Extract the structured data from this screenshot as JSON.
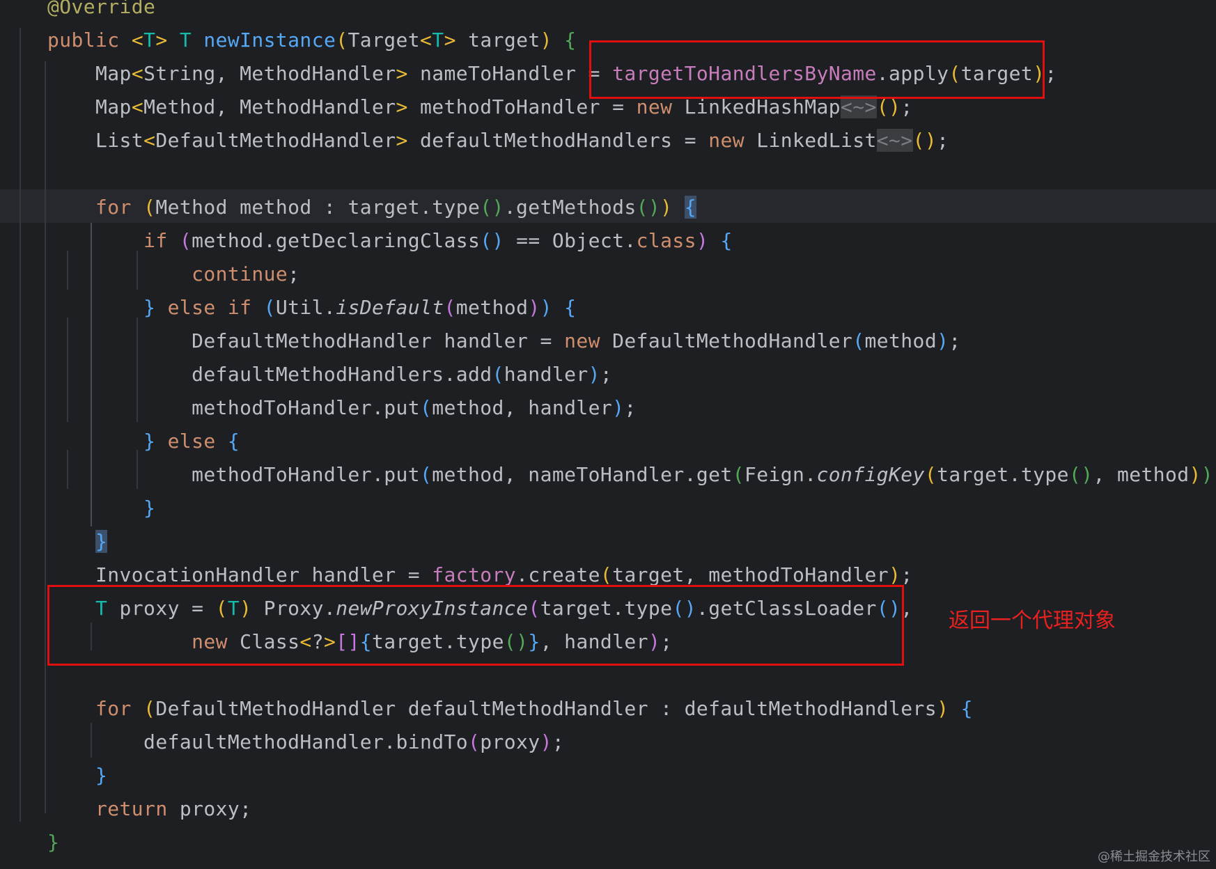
{
  "colors": {
    "background": "#1e1f22",
    "keyword": "#cf8e6d",
    "method": "#56a8f5",
    "field": "#c77dbb",
    "type_param": "#16baac",
    "annotation": "#b3ae60",
    "highlight_box": "#e01010"
  },
  "code": {
    "lines": [
      [
        [
          "@Override",
          "ann"
        ]
      ],
      [
        [
          "public ",
          "kw"
        ],
        [
          "<",
          "p1"
        ],
        [
          "T",
          "tp"
        ],
        [
          "> ",
          "p1"
        ],
        [
          "T ",
          "tp"
        ],
        [
          "newInstance",
          "fn"
        ],
        [
          "(",
          "p1"
        ],
        [
          "Target",
          "type"
        ],
        [
          "<",
          "p1"
        ],
        [
          "T",
          "tp"
        ],
        [
          "> ",
          "p1"
        ],
        [
          "target",
          ""
        ],
        [
          ") ",
          "p1"
        ],
        [
          "{",
          "p4"
        ]
      ],
      [
        [
          "    Map",
          ""
        ],
        [
          "<",
          "p1"
        ],
        [
          "String, MethodHandler",
          ""
        ],
        [
          "> ",
          "p1"
        ],
        [
          "nameToHandler = ",
          ""
        ],
        [
          "targetToHandlersByName",
          "field"
        ],
        [
          ".apply",
          ""
        ],
        [
          "(",
          "p1"
        ],
        [
          "target",
          ""
        ],
        [
          ")",
          "p1"
        ],
        [
          ";",
          ""
        ]
      ],
      [
        [
          "    Map",
          ""
        ],
        [
          "<",
          "p1"
        ],
        [
          "Method, MethodHandler",
          ""
        ],
        [
          "> ",
          "p1"
        ],
        [
          "methodToHandler = ",
          ""
        ],
        [
          "new ",
          "kw"
        ],
        [
          "LinkedHashMap",
          ""
        ],
        [
          "<~>",
          "dim"
        ],
        [
          "()",
          "p1"
        ],
        [
          ";",
          ""
        ]
      ],
      [
        [
          "    List",
          ""
        ],
        [
          "<",
          "p1"
        ],
        [
          "DefaultMethodHandler",
          ""
        ],
        [
          "> ",
          "p1"
        ],
        [
          "defaultMethodHandlers = ",
          ""
        ],
        [
          "new ",
          "kw"
        ],
        [
          "LinkedList",
          ""
        ],
        [
          "<~>",
          "dim"
        ],
        [
          "()",
          "p1"
        ],
        [
          ";",
          ""
        ]
      ],
      [
        [
          "",
          ""
        ]
      ],
      [
        [
          "    ",
          ""
        ],
        [
          "for ",
          "kw"
        ],
        [
          "(",
          "p1"
        ],
        [
          "Method method : target.type",
          ""
        ],
        [
          "()",
          "p4"
        ],
        [
          ".getMethods",
          ""
        ],
        [
          "()",
          "p4"
        ],
        [
          ")",
          "p1"
        ],
        [
          " ",
          ""
        ],
        [
          "{",
          "match"
        ]
      ],
      [
        [
          "        ",
          ""
        ],
        [
          "if ",
          "kw"
        ],
        [
          "(",
          "p2"
        ],
        [
          "method.getDeclaringClass",
          ""
        ],
        [
          "()",
          "p3"
        ],
        [
          " == Object.",
          ""
        ],
        [
          "class",
          "kw"
        ],
        [
          ") ",
          "p2"
        ],
        [
          "{",
          "p3"
        ]
      ],
      [
        [
          "            ",
          ""
        ],
        [
          "continue",
          "kw"
        ],
        [
          ";",
          ""
        ]
      ],
      [
        [
          "        ",
          ""
        ],
        [
          "} ",
          "p3"
        ],
        [
          "else if ",
          "kw"
        ],
        [
          "(",
          "p3"
        ],
        [
          "Util.",
          ""
        ],
        [
          "isDefault",
          "italic"
        ],
        [
          "(",
          "p2"
        ],
        [
          "method",
          ""
        ],
        [
          ")",
          "p2"
        ],
        [
          ") ",
          "p3"
        ],
        [
          "{",
          "p3"
        ]
      ],
      [
        [
          "            DefaultMethodHandler handler = ",
          ""
        ],
        [
          "new ",
          "kw"
        ],
        [
          "DefaultMethodHandler",
          ""
        ],
        [
          "(",
          "p3"
        ],
        [
          "method",
          ""
        ],
        [
          ")",
          "p3"
        ],
        [
          ";",
          ""
        ]
      ],
      [
        [
          "            defaultMethodHandlers.add",
          ""
        ],
        [
          "(",
          "p3"
        ],
        [
          "handler",
          ""
        ],
        [
          ")",
          "p3"
        ],
        [
          ";",
          ""
        ]
      ],
      [
        [
          "            methodToHandler.put",
          ""
        ],
        [
          "(",
          "p3"
        ],
        [
          "method, handler",
          ""
        ],
        [
          ")",
          "p3"
        ],
        [
          ";",
          ""
        ]
      ],
      [
        [
          "        ",
          ""
        ],
        [
          "} ",
          "p3"
        ],
        [
          "else ",
          "kw"
        ],
        [
          "{",
          "p3"
        ]
      ],
      [
        [
          "            methodToHandler.put",
          ""
        ],
        [
          "(",
          "p3"
        ],
        [
          "method, nameToHandler.get",
          ""
        ],
        [
          "(",
          "p4"
        ],
        [
          "Feign.",
          ""
        ],
        [
          "configKey",
          "italic"
        ],
        [
          "(",
          "p1"
        ],
        [
          "target.type",
          ""
        ],
        [
          "()",
          "p4"
        ],
        [
          ", method",
          ""
        ],
        [
          ")",
          "p1"
        ],
        [
          ")",
          "p4"
        ],
        [
          ")",
          "p3"
        ],
        [
          ";",
          ""
        ]
      ],
      [
        [
          "        ",
          ""
        ],
        [
          "}",
          "p3"
        ]
      ],
      [
        [
          "    ",
          ""
        ],
        [
          "}",
          "match"
        ]
      ],
      [
        [
          "    InvocationHandler handler = ",
          ""
        ],
        [
          "factory",
          "field"
        ],
        [
          ".create",
          ""
        ],
        [
          "(",
          "p1"
        ],
        [
          "target, methodToHandler",
          ""
        ],
        [
          ")",
          "p1"
        ],
        [
          ";",
          ""
        ]
      ],
      [
        [
          "    ",
          ""
        ],
        [
          "T ",
          "tp"
        ],
        [
          "proxy = ",
          ""
        ],
        [
          "(",
          "p1"
        ],
        [
          "T",
          "tp"
        ],
        [
          ") ",
          "p1"
        ],
        [
          "Proxy.",
          ""
        ],
        [
          "newProxyInstance",
          "italic"
        ],
        [
          "(",
          "p2"
        ],
        [
          "target.type",
          ""
        ],
        [
          "()",
          "p3"
        ],
        [
          ".getClassLoader",
          ""
        ],
        [
          "()",
          "p3"
        ],
        [
          ",",
          ""
        ]
      ],
      [
        [
          "            ",
          ""
        ],
        [
          "new ",
          "kw"
        ],
        [
          "Class",
          ""
        ],
        [
          "<",
          "p1"
        ],
        [
          "?",
          ""
        ],
        [
          ">",
          "p1"
        ],
        [
          "[]",
          "p2"
        ],
        [
          "{",
          "p3"
        ],
        [
          "target.type",
          ""
        ],
        [
          "()",
          "p4"
        ],
        [
          "}",
          "p3"
        ],
        [
          ", handler",
          ""
        ],
        [
          ")",
          "p2"
        ],
        [
          ";",
          ""
        ]
      ],
      [
        [
          "",
          ""
        ]
      ],
      [
        [
          "    ",
          ""
        ],
        [
          "for ",
          "kw"
        ],
        [
          "(",
          "p1"
        ],
        [
          "DefaultMethodHandler defaultMethodHandler : defaultMethodHandlers",
          ""
        ],
        [
          ") ",
          "p1"
        ],
        [
          "{",
          "p3"
        ]
      ],
      [
        [
          "        defaultMethodHandler.bindTo",
          ""
        ],
        [
          "(",
          "p2"
        ],
        [
          "proxy",
          ""
        ],
        [
          ")",
          "p2"
        ],
        [
          ";",
          ""
        ]
      ],
      [
        [
          "    ",
          ""
        ],
        [
          "}",
          "p3"
        ]
      ],
      [
        [
          "    ",
          ""
        ],
        [
          "return ",
          "kw"
        ],
        [
          "proxy;",
          ""
        ]
      ],
      [
        [
          "}",
          "p4"
        ]
      ]
    ]
  },
  "annotation_note": "返回一个代理对象",
  "watermark": "@稀土掘金技术社区"
}
